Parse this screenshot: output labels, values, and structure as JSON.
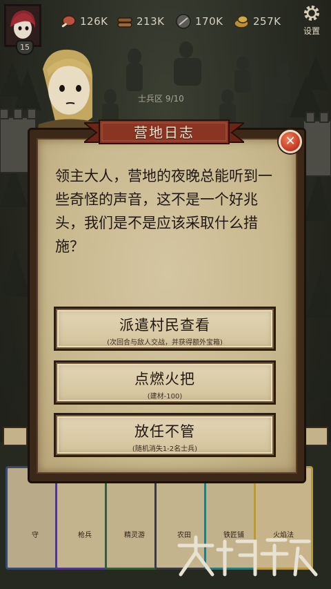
{
  "player": {
    "level": "15"
  },
  "resources": [
    {
      "icon": "meat-icon",
      "value": "126K"
    },
    {
      "icon": "wood-icon",
      "value": "213K"
    },
    {
      "icon": "iron-icon",
      "value": "170K"
    },
    {
      "icon": "gold-icon",
      "value": "257K"
    }
  ],
  "settings_label": "设置",
  "scene": {
    "soldier_area_label": "士兵区 9/10"
  },
  "dialog": {
    "title": "营地日志",
    "close_icon": "close-icon",
    "message": "领主大人，营地的夜晚总能听到一些奇怪的声音，这不是一个好兆头，我们是不是应该采取什么措施？",
    "choices": [
      {
        "label": "派遣村民查看",
        "note": "(次回合与敌人交战，并获得额外宝箱)"
      },
      {
        "label": "点燃火把",
        "note": "(建材-100)"
      },
      {
        "label": "放任不管",
        "note": "(随机消失1-2名士兵)"
      }
    ]
  },
  "cards": [
    {
      "name": "守"
    },
    {
      "name": "枪兵"
    },
    {
      "name": "精灵游"
    },
    {
      "name": "农田"
    },
    {
      "name": "铁匠铺"
    },
    {
      "name": "火焰法"
    }
  ],
  "colors": {
    "parchment": "#d0c19a",
    "frame": "#3b2818",
    "ribbon": "#8a3424",
    "close": "#c9412b"
  }
}
